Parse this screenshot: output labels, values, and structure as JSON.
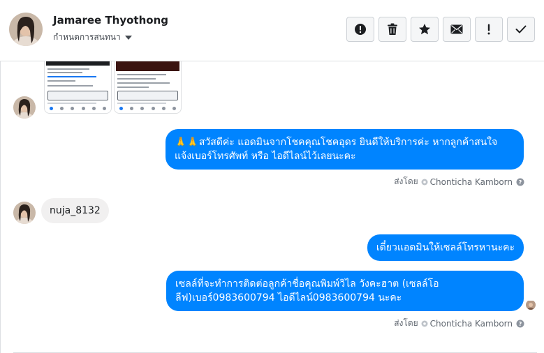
{
  "header": {
    "contact_name": "Jamaree Thyothong",
    "assign_label": "กำหนดการสนทนา",
    "actions": [
      {
        "icon": "alert-circle-icon",
        "name": "mark-spam-button"
      },
      {
        "icon": "trash-icon",
        "name": "delete-button"
      },
      {
        "icon": "star-icon",
        "name": "star-button"
      },
      {
        "icon": "envelope-icon",
        "name": "mark-unread-button"
      },
      {
        "icon": "exclamation-icon",
        "name": "follow-up-button"
      },
      {
        "icon": "check-icon",
        "name": "mark-done-button"
      }
    ]
  },
  "messages": {
    "greeting": "🙏🙏สวัสดีค่ะ แอดมินจากโชคคุณโชคอุดร ยินดีให้บริการค่ะ หากลูกค้าสนใจ แจ้งเบอร์โทรศัพท์ หรือ ไอดีไลน์ไว้เลยนะคะ",
    "customer_reply": "nuja_8132",
    "handoff": "เดี๋ยวแอดมินให้เซลล์โทรหานะคะ",
    "sales_info": "เซลล์ที่จะทำการติดต่อลูกค้าชื่อคุณพิมพ์วิไล วังคะฮาต (เซลล์โอลีฟ)เบอร์0983600794 ไอดีไลน์0983600794 นะคะ"
  },
  "sent_by": {
    "prefix": "ส่งโดย",
    "agent": "Chonticha Kamborn"
  },
  "colors": {
    "outgoing_bubble": "#0084ff",
    "incoming_bubble": "#f1f0f0",
    "meta_text": "#606770"
  }
}
